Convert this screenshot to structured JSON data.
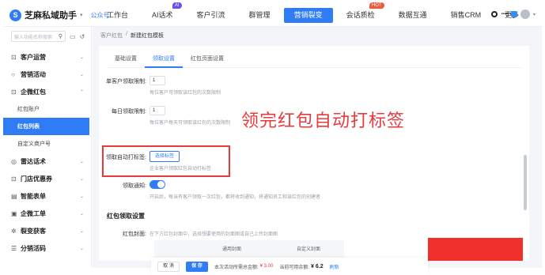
{
  "app": {
    "name": "芝麻私域助手",
    "account_tag": "公众号"
  },
  "nav": {
    "items": [
      {
        "label": "工作台"
      },
      {
        "label": "AI话术",
        "badge": "AI"
      },
      {
        "label": "客户引流"
      },
      {
        "label": "群管理"
      },
      {
        "label": "营销裂变",
        "active": true
      },
      {
        "label": "会话质检",
        "badge": "HOT"
      },
      {
        "label": "数据互通"
      },
      {
        "label": "销售CRM"
      },
      {
        "label": "更多"
      }
    ]
  },
  "sidebar": {
    "search_placeholder": "输入功能名称搜索",
    "items": [
      {
        "icon": "customer-icon",
        "label": "客户运营"
      },
      {
        "icon": "marketing-icon",
        "label": "营销活动"
      },
      {
        "icon": "redpacket-icon",
        "label": "企微红包",
        "expanded": true,
        "children": [
          {
            "label": "红包账户"
          },
          {
            "label": "红包列表",
            "active": true
          },
          {
            "label": "自定义商户号"
          }
        ]
      },
      {
        "icon": "radar-icon",
        "label": "雷达话术"
      },
      {
        "icon": "coupon-icon",
        "label": "门店优惠券"
      },
      {
        "icon": "form-icon",
        "label": "智能表单"
      },
      {
        "icon": "ticket-icon",
        "label": "企微工单"
      },
      {
        "icon": "fission-icon",
        "label": "裂变获客"
      },
      {
        "icon": "distribution-icon",
        "label": "分销活码"
      }
    ]
  },
  "breadcrumb": {
    "parent": "客户红包",
    "separator": "/",
    "current": "新建红包模板"
  },
  "tabs": [
    {
      "label": "基础设置"
    },
    {
      "label": "领取设置",
      "active": true
    },
    {
      "label": "红包页面设置"
    }
  ],
  "form": {
    "single_limit_label": "单客户领取限制:",
    "single_limit_value": "1",
    "single_limit_hint": "每位客户可领取该红包的次数限制",
    "daily_limit_label": "每日领取限制:",
    "daily_limit_value": "1",
    "daily_limit_hint": "每位客户每天可领取该红包的次数限制",
    "auto_tag_label": "领取自动打标签:",
    "auto_tag_button": "选择标签",
    "auto_tag_hint": "企业客户领取红包自动打标签",
    "notify_label": "领取通知:",
    "notify_on": true,
    "notify_hint": "开启后，每当有客户领取一次红包，都将收到通知，将通知员工和该红包的创建者"
  },
  "annotation": "领完红包自动打标签",
  "receive_section": {
    "title": "红包领取设置",
    "cover_label": "红包封面:",
    "cover_hint": "在下方红包封面中，选择想要使用的封面图或自己上传封面图",
    "col_general": "通用封面",
    "col_custom": "自定义封面"
  },
  "footer": {
    "cancel": "取 消",
    "save": "保 存",
    "estimate_label": "本次活动所需总金额:",
    "estimate_value": "¥ 3.00",
    "balance_label": "当前可用余额:",
    "balance_value": "¥ 6.2",
    "refresh": "刷新"
  },
  "colors": {
    "primary": "#2f7cf6",
    "annotation_red": "#e8393b",
    "preview_red": "#f0302a"
  }
}
